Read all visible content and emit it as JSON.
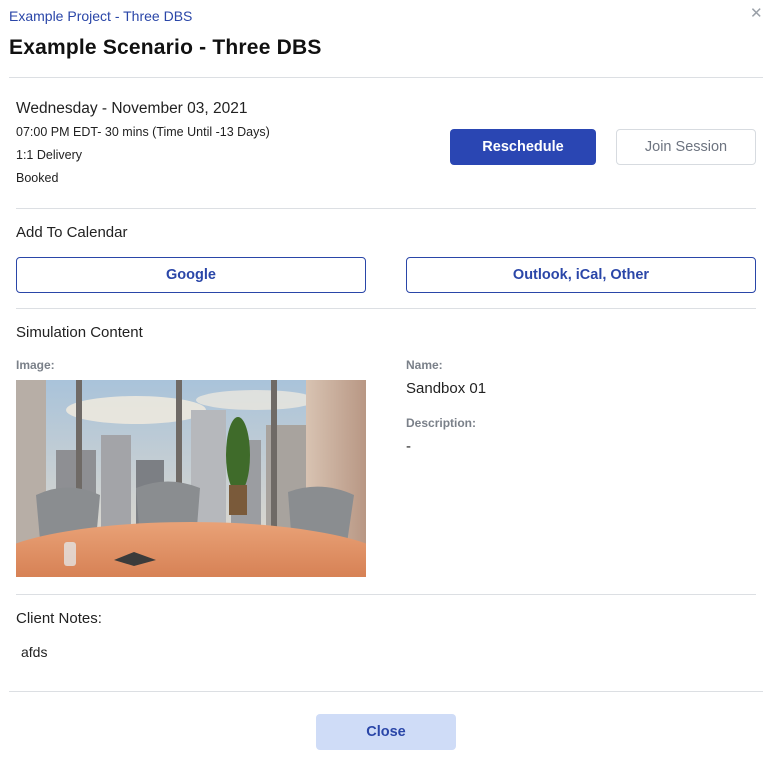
{
  "dialog": {
    "project_link": "Example Project - Three DBS",
    "close_icon": "close-icon",
    "title": "Example Scenario - Three DBS"
  },
  "session": {
    "date": "Wednesday - November 03, 2021",
    "time": "07:00 PM EDT- 30 mins (Time Until -13 Days)",
    "delivery": "1:1 Delivery",
    "status": "Booked",
    "reschedule_label": "Reschedule",
    "join_label": "Join Session"
  },
  "calendar": {
    "heading": "Add To Calendar",
    "google_label": "Google",
    "other_label": "Outlook, iCal, Other"
  },
  "content": {
    "heading": "Simulation Content",
    "image_label": "Image:",
    "name_label": "Name:",
    "name_value": "Sandbox 01",
    "description_label": "Description:",
    "description_value": "-"
  },
  "notes": {
    "heading": "Client Notes:",
    "text": "afds"
  },
  "footer": {
    "close_label": "Close"
  },
  "colors": {
    "accent": "#2a46b3",
    "close_button_bg": "#cfdcf7"
  }
}
